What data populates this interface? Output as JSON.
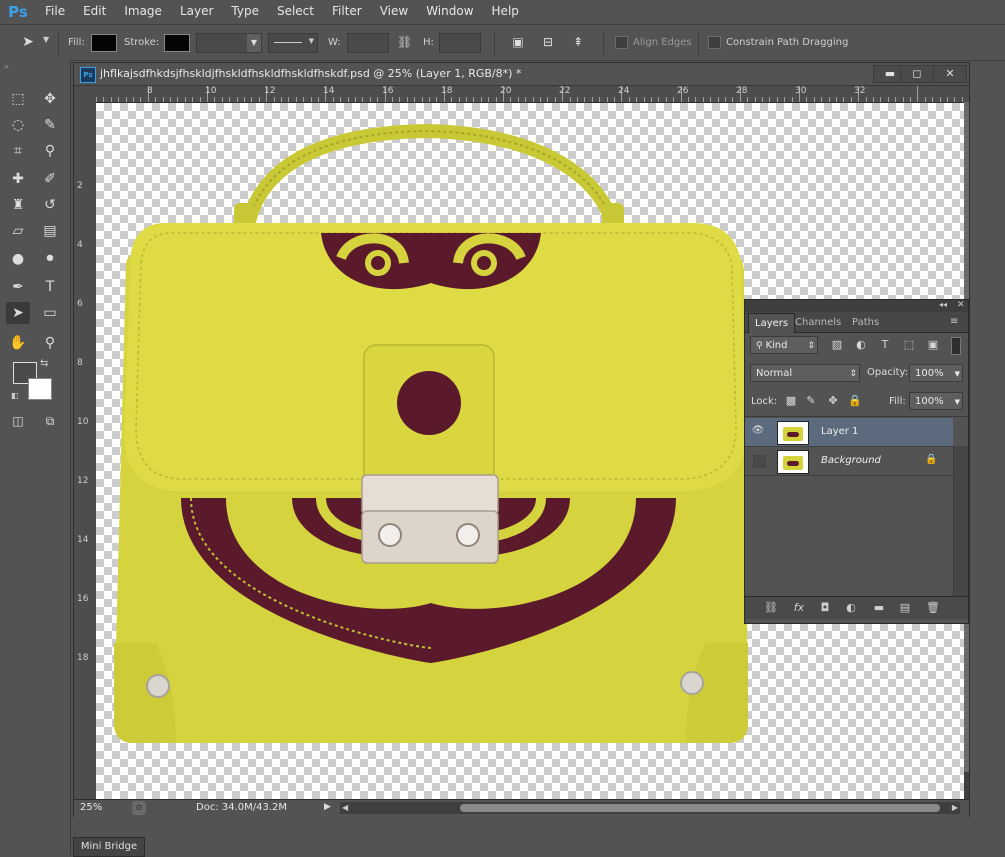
{
  "app": {
    "logo": "Ps"
  },
  "menu": [
    "File",
    "Edit",
    "Image",
    "Layer",
    "Type",
    "Select",
    "Filter",
    "View",
    "Window",
    "Help"
  ],
  "options": {
    "fill_label": "Fill:",
    "stroke_label": "Stroke:",
    "w_label": "W:",
    "h_label": "H:",
    "align_edges": "Align Edges",
    "constrain": "Constrain Path Dragging"
  },
  "document": {
    "title": "jhflkajsdfhkdsjfhskldjfhskldfhskldfhskldfhskdf.psd @ 25% (Layer 1, RGB/8*) *",
    "minimize": "▬",
    "restore": "◻",
    "close": "✕",
    "ruler_h": [
      "8",
      "10",
      "12",
      "14",
      "16",
      "18",
      "20",
      "22",
      "24",
      "26",
      "28",
      "30",
      "32"
    ],
    "ruler_v": [
      "2",
      "4",
      "6",
      "8",
      "10",
      "12",
      "14",
      "16",
      "18"
    ],
    "zoom": "25%",
    "doc_size": "Doc: 34.0M/43.2M"
  },
  "mini_bridge": "Mini Bridge",
  "layers_panel": {
    "tabs": [
      "Layers",
      "Channels",
      "Paths"
    ],
    "filter_kind": "Kind",
    "blend_mode": "Normal",
    "opacity_label": "Opacity:",
    "opacity_value": "100%",
    "lock_label": "Lock:",
    "fill_label": "Fill:",
    "fill_value": "100%",
    "layers": [
      {
        "name": "Layer 1",
        "visible": true,
        "selected": true
      },
      {
        "name": "Background",
        "visible": false,
        "selected": false,
        "locked": true
      }
    ]
  },
  "colors": {
    "bag_yellow": "#d6d43e",
    "bag_maroon": "#5a1a2c",
    "ui_dark": "#535353"
  }
}
